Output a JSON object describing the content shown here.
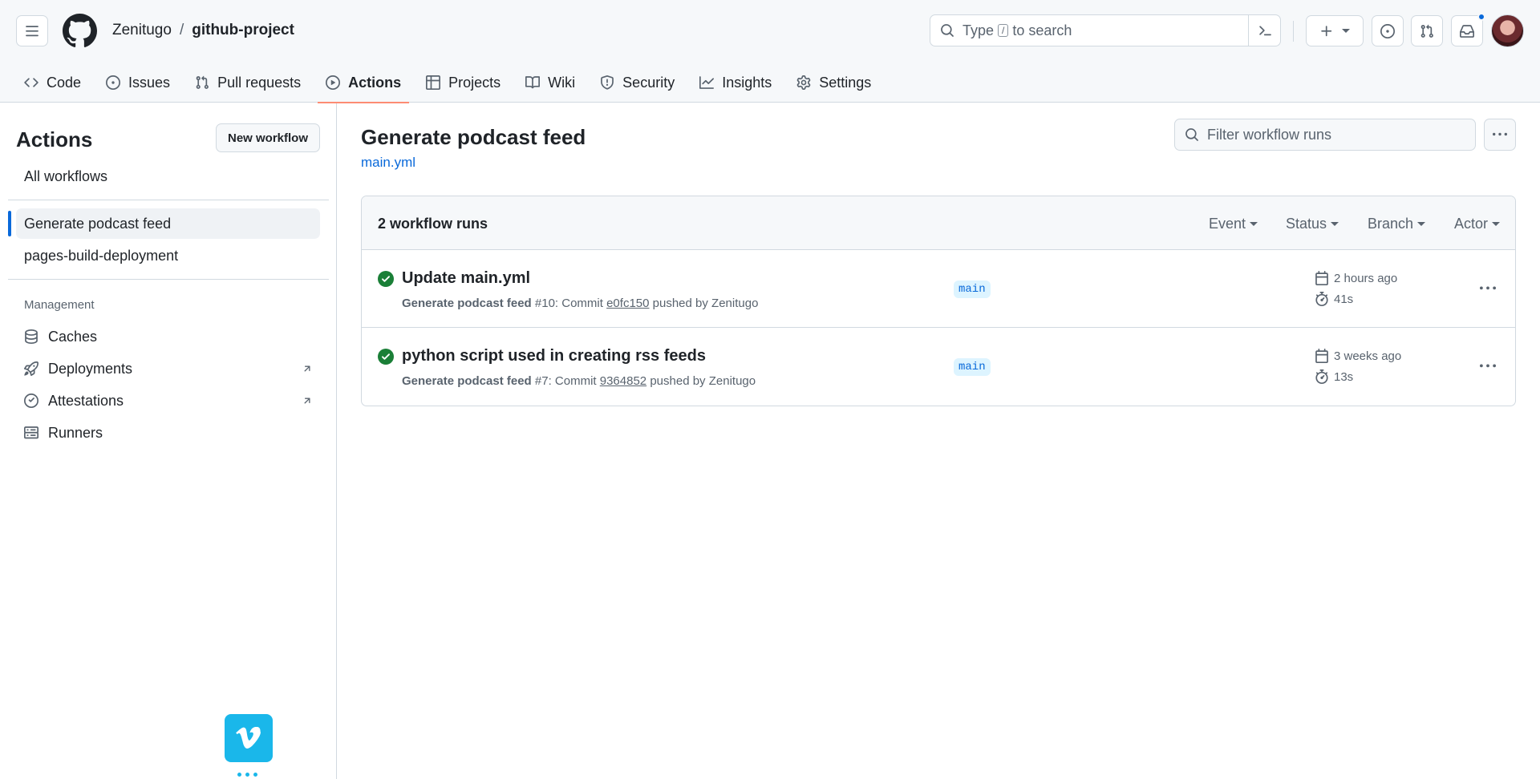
{
  "header": {
    "owner": "Zenitugo",
    "separator": "/",
    "repo": "github-project",
    "search": {
      "prefix": "Type",
      "key": "/",
      "suffix": "to search"
    }
  },
  "tabs": [
    {
      "label": "Code",
      "icon": "code-icon"
    },
    {
      "label": "Issues",
      "icon": "issue-opened-icon"
    },
    {
      "label": "Pull requests",
      "icon": "git-pull-request-icon"
    },
    {
      "label": "Actions",
      "icon": "play-icon",
      "active": true
    },
    {
      "label": "Projects",
      "icon": "table-icon"
    },
    {
      "label": "Wiki",
      "icon": "book-icon"
    },
    {
      "label": "Security",
      "icon": "shield-icon"
    },
    {
      "label": "Insights",
      "icon": "graph-icon"
    },
    {
      "label": "Settings",
      "icon": "gear-icon"
    }
  ],
  "sidebar": {
    "title": "Actions",
    "new_workflow": "New workflow",
    "all_workflows": "All workflows",
    "workflows": [
      {
        "label": "Generate podcast feed",
        "selected": true
      },
      {
        "label": "pages-build-deployment"
      }
    ],
    "management_label": "Management",
    "management": [
      {
        "label": "Caches",
        "icon": "database-icon"
      },
      {
        "label": "Deployments",
        "icon": "rocket-icon",
        "external": true
      },
      {
        "label": "Attestations",
        "icon": "verified-icon",
        "external": true
      },
      {
        "label": "Runners",
        "icon": "server-icon"
      }
    ]
  },
  "main": {
    "title": "Generate podcast feed",
    "file": "main.yml",
    "filter_placeholder": "Filter workflow runs",
    "runs_count": "2 workflow runs",
    "filters": [
      "Event",
      "Status",
      "Branch",
      "Actor"
    ],
    "runs": [
      {
        "title": "Update main.yml",
        "workflow": "Generate podcast feed",
        "number": "#10: Commit",
        "commit": "e0fc150",
        "pushed_by": "pushed by Zenitugo",
        "branch": "main",
        "when": "2 hours ago",
        "duration": "41s",
        "status": "success"
      },
      {
        "title": "python script used in creating rss feeds",
        "workflow": "Generate podcast feed",
        "number": "#7: Commit",
        "commit": "9364852",
        "pushed_by": "pushed by Zenitugo",
        "branch": "main",
        "when": "3 weeks ago",
        "duration": "13s",
        "status": "success"
      }
    ]
  },
  "colors": {
    "accent": "#0969da",
    "success": "#1a7f37",
    "tab_underline": "#fd8c73",
    "vimeo": "#1ab7ea"
  }
}
